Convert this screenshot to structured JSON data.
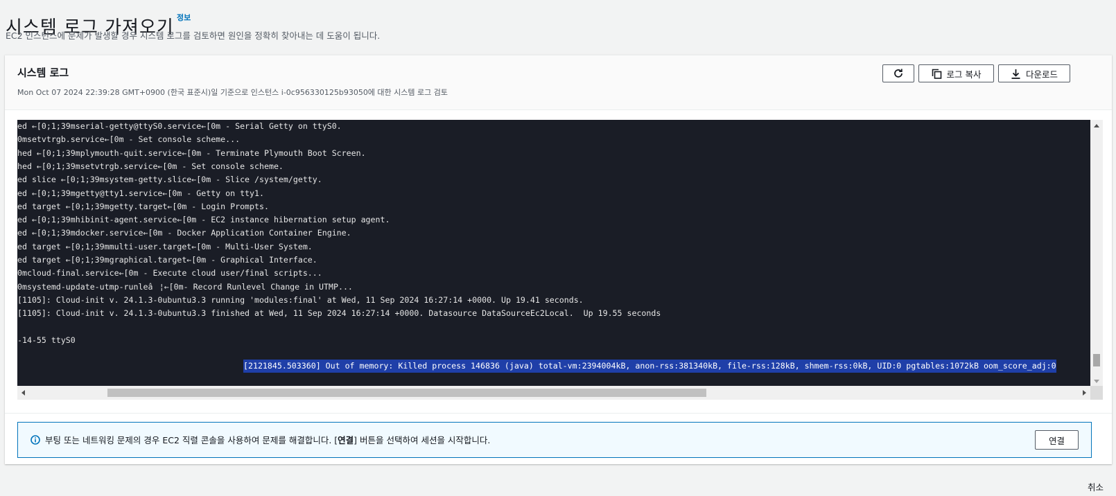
{
  "page": {
    "title": "시스템 로그 가져오기",
    "info_link": "정보",
    "description": "EC2 인스턴스에 문제가 발생할 경우 시스템 로그를 검토하면 원인을 정확히 찾아내는 데 도움이 됩니다."
  },
  "panel": {
    "title": "시스템 로그",
    "subtitle": "Mon Oct 07 2024 22:39:28 GMT+0900 (한국 표준시)일 기준으로 인스턴스 i-0c956330125b93050에 대한 시스템 로그 검토",
    "buttons": {
      "refresh_icon": "refresh-icon",
      "copy_label": "로그 복사",
      "copy_icon": "copy-icon",
      "download_label": "다운로드",
      "download_icon": "download-icon"
    }
  },
  "log": {
    "lines": [
      "ed ←[0;1;39mserial-getty@ttyS0.service←[0m - Serial Getty on ttyS0.",
      "0msetvtrgb.service←[0m - Set console scheme...",
      "hed ←[0;1;39mplymouth-quit.service←[0m - Terminate Plymouth Boot Screen.",
      "hed ←[0;1;39msetvtrgb.service←[0m - Set console scheme.",
      "ed slice ←[0;1;39msystem-getty.slice←[0m - Slice /system/getty.",
      "ed ←[0;1;39mgetty@tty1.service←[0m - Getty on tty1.",
      "ed target ←[0;1;39mgetty.target←[0m - Login Prompts.",
      "ed ←[0;1;39mhibinit-agent.service←[0m - EC2 instance hibernation setup agent.",
      "ed ←[0;1;39mdocker.service←[0m - Docker Application Container Engine.",
      "ed target ←[0;1;39mmulti-user.target←[0m - Multi-User System.",
      "ed target ←[0;1;39mgraphical.target←[0m - Graphical Interface.",
      "0mcloud-final.service←[0m - Execute cloud user/final scripts...",
      "0msystemd-update-utmp-runleâ¦←[0m- Record Runlevel Change in UTMP...",
      "[1105]: Cloud-init v. 24.1.3-0ubuntu3.3 running 'modules:final' at Wed, 11 Sep 2024 16:27:14 +0000. Up 19.41 seconds.",
      "[1105]: Cloud-init v. 24.1.3-0ubuntu3.3 finished at Wed, 11 Sep 2024 16:27:14 +0000. Datasource DataSourceEc2Local.  Up 19.55 seconds",
      "",
      "-14-55 ttyS0",
      "",
      "[2121845.503360] Out of memory: Killed process 146836 (java) total-vm:2394004kB, anon-rss:381340kB, file-rss:128kB, shmem-rss:0kB, UID:0 pgtables:1072kB oom_score_adj:0"
    ],
    "selected_line_index": 18,
    "horizontal_scroll_position": 0.07,
    "horizontal_scroll_visible_fraction": 0.57,
    "vertical_scroll_position": 0.97
  },
  "alert": {
    "icon": "info-icon",
    "text_before": "부팅 또는 네트워킹 문제의 경우 EC2 직렬 콘솔을 사용하여 문제를 해결합니다. [",
    "text_bold": "연결",
    "text_after": "] 버튼을 선택하여 세션을 시작합니다.",
    "button_label": "연결"
  },
  "footer": {
    "cancel_label": "취소"
  },
  "colors": {
    "terminal_background": "#1a1d26",
    "selection": "#1f3fa8",
    "link": "#0073bb",
    "alert_border": "#0073bb"
  }
}
